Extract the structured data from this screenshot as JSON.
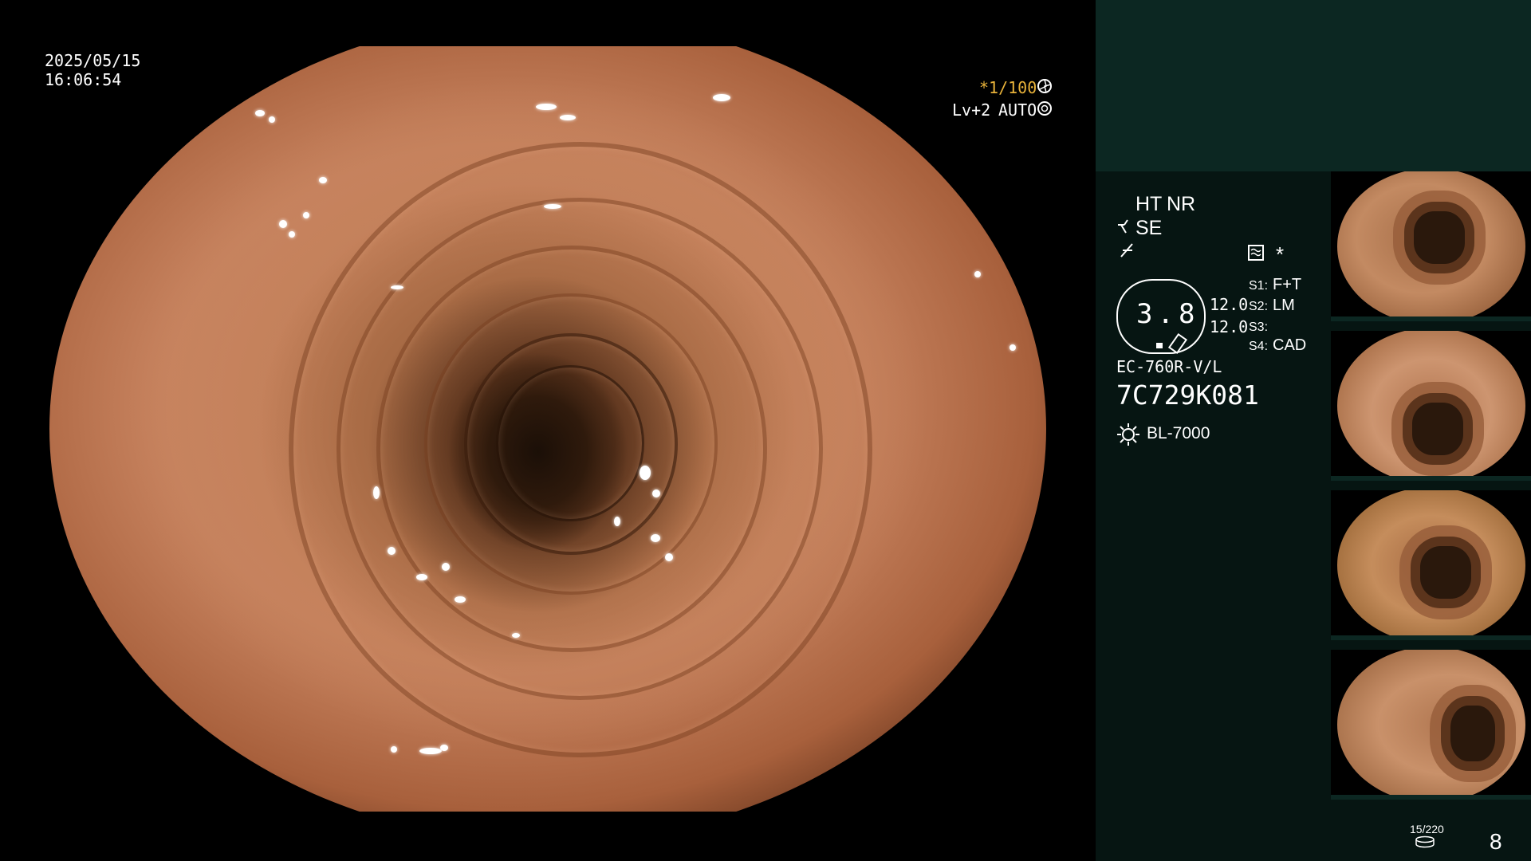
{
  "overlay": {
    "date": "2025/05/15",
    "time": "16:06:54",
    "shutter": "*1/100",
    "level": "Lv+2",
    "auto": "AUTO"
  },
  "panel": {
    "ht": "HT",
    "nr": "NR",
    "se": "SE",
    "star": "*",
    "zoom": "3.8",
    "val1": "12.0",
    "val2": "12.0",
    "s1_key": "S1:",
    "s1_val": "F+T",
    "s2_key": "S2:",
    "s2_val": "LM",
    "s3_key": "S3:",
    "s3_val": "",
    "s4_key": "S4:",
    "s4_val": "CAD",
    "scope_model": "EC-760R-V/L",
    "serial": "7C729K081",
    "light_source": "BL-7000",
    "storage": "15/220",
    "count": "8"
  },
  "colors": {
    "accent_yellow": "#e8b23a",
    "panel_top": "#0c2722",
    "panel_bg": "#061512"
  },
  "icons": [
    "camera-shutter-icon",
    "auto-iris-icon",
    "scope-angle-icon",
    "freeze-icon",
    "image-mode-icon",
    "light-source-icon",
    "storage-media-icon"
  ]
}
